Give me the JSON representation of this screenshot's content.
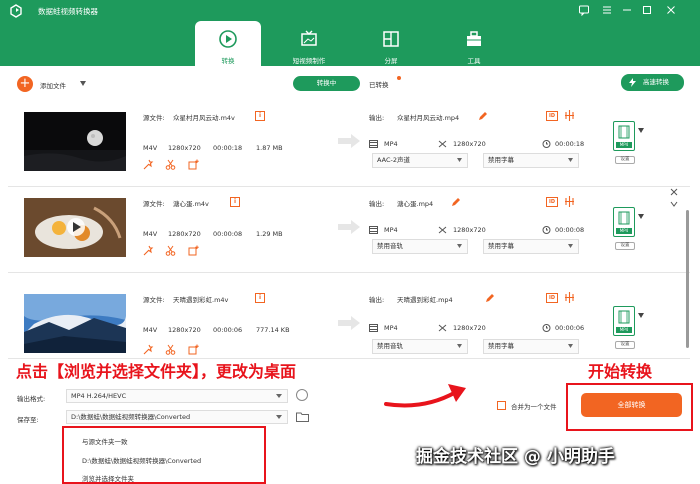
{
  "app": {
    "title": "数据蛙视频转换器"
  },
  "nav": {
    "tabs": [
      {
        "label": "转换",
        "icon": "convert-icon",
        "active": true
      },
      {
        "label": "短视频制作",
        "icon": "short-video-icon",
        "active": false
      },
      {
        "label": "分屏",
        "icon": "split-screen-icon",
        "active": false
      },
      {
        "label": "工具",
        "icon": "toolbox-icon",
        "active": false
      }
    ]
  },
  "toolbar": {
    "add_label": "添加文件",
    "converting_label": "转换中",
    "converted_label": "已转换",
    "fast_label": "高速转换"
  },
  "common": {
    "src_label": "源文件:",
    "out_label": "输出:",
    "settings_label": "设置",
    "format_badge": "MP4"
  },
  "files": [
    {
      "src_name": "众星村月风云动.m4v",
      "format": "M4V",
      "resolution": "1280x720",
      "duration": "00:00:18",
      "size": "1.87 MB",
      "out_name": "众星村月风云动.mp4",
      "out_format": "MP4",
      "out_resolution": "1280x720",
      "out_duration": "00:00:18",
      "audio": "AAC-2声道",
      "subtitle": "禁用字幕"
    },
    {
      "src_name": "溏心蛋.m4v",
      "format": "M4V",
      "resolution": "1280x720",
      "duration": "00:00:08",
      "size": "1.29 MB",
      "out_name": "溏心蛋.mp4",
      "out_format": "MP4",
      "out_resolution": "1280x720",
      "out_duration": "00:00:08",
      "audio": "禁用音轨",
      "subtitle": "禁用字幕"
    },
    {
      "src_name": "天晴遇到彩虹.m4v",
      "format": "M4V",
      "resolution": "1280x720",
      "duration": "00:00:06",
      "size": "777.14 KB",
      "out_name": "天晴遇到彩虹.mp4",
      "out_format": "MP4",
      "out_resolution": "1280x720",
      "out_duration": "00:00:06",
      "audio": "禁用音轨",
      "subtitle": "禁用字幕"
    }
  ],
  "annotations": {
    "left": "点击【浏览并选择文件夹】，更改为桌面",
    "right": "开始转换"
  },
  "bottom": {
    "output_format_label": "输出格式:",
    "output_format_value": "MP4 H.264/HEVC",
    "save_to_label": "保存至:",
    "save_to_value": "D:\\数据蛙\\数据蛙视频转换器\\Converted",
    "merge_label": "合并为一个文件",
    "start_label": "全部转换"
  },
  "dropdown": {
    "options": [
      "与源文件夹一致",
      "D:\\数据蛙\\数据蛙视频转换器\\Converted",
      "浏览并选择文件夹"
    ]
  },
  "watermark": "掘金技术社区 @ 小明助手",
  "colors": {
    "primary": "#1e9a5c",
    "accent": "#f26522",
    "annotation": "#e8141c"
  }
}
